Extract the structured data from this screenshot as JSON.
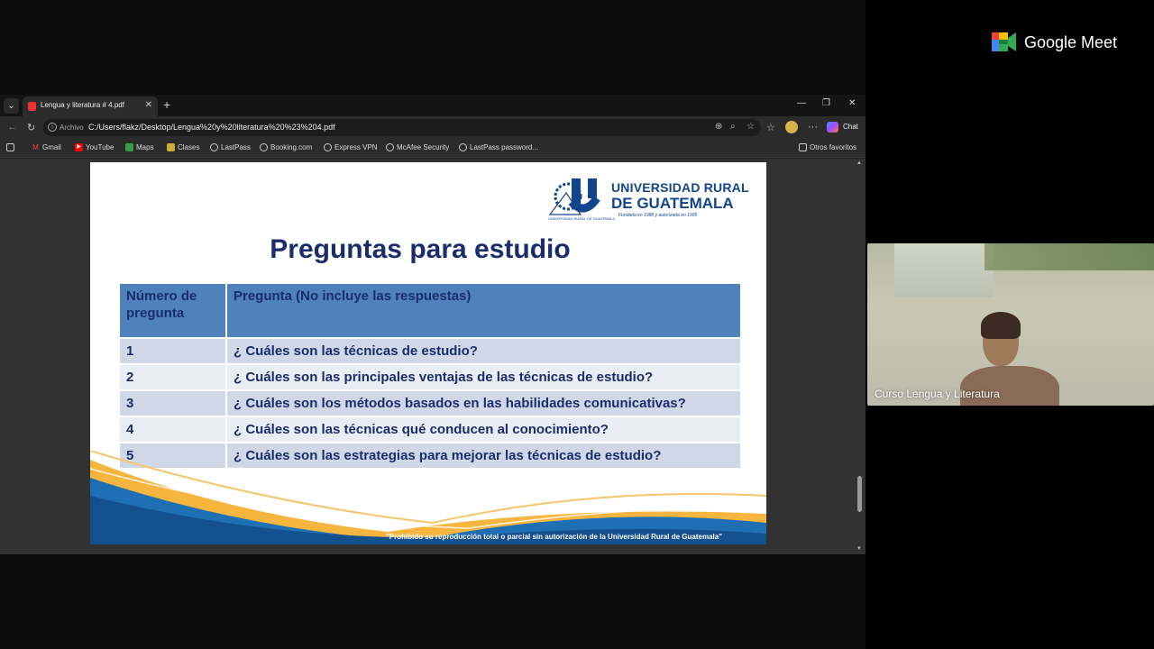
{
  "meet": {
    "brand": "Google Meet",
    "participant_name": "Curso Lengua y Literatura"
  },
  "browser": {
    "tab_title": "Lengua y literatura # 4.pdf",
    "address_scheme": "Archivo",
    "url": "C:/Users/flakz/Desktop/Lengua%20y%20literatura%20%23%204.pdf",
    "chat_label": "Chat",
    "bookmarks": [
      "Gmail",
      "YouTube",
      "Maps",
      "Clases",
      "LastPass",
      "Booking.com",
      "Express VPN",
      "McAfee Security",
      "LastPass password..."
    ],
    "other_favorites": "Otros favoritos"
  },
  "slide": {
    "logo": {
      "line1": "UNIVERSIDAD RURAL",
      "line2": "DE GUATEMALA",
      "tagline": "Fundada en 1988 y autorizada en 1995",
      "small": "UNIVERSIDAD RURAL DE GUATEMALA"
    },
    "title": "Preguntas para estudio",
    "table": {
      "headers": [
        "Número de pregunta",
        "Pregunta (No incluye las respuestas)"
      ],
      "rows": [
        {
          "num": "1",
          "question": "¿ Cuáles son las técnicas de estudio?"
        },
        {
          "num": "2",
          "question": "¿ Cuáles son las principales ventajas de las técnicas de estudio?"
        },
        {
          "num": "3",
          "question": "¿ Cuáles son los métodos basados en las habilidades comunicativas?"
        },
        {
          "num": "4",
          "question": "¿ Cuáles son las técnicas qué conducen al conocimiento?"
        },
        {
          "num": "5",
          "question": "¿ Cuáles son las estrategias para mejorar  las técnicas de estudio?"
        }
      ]
    },
    "footer": "\"Prohibido su reproducción total o parcial sin autorización de la Universidad Rural de Guatemala\""
  },
  "colors": {
    "title": "#1a2d6b",
    "header_fill": "#4f81bd",
    "row_odd": "#d0d8e8",
    "row_even": "#e9edf4",
    "brand_blue": "#12458c"
  }
}
